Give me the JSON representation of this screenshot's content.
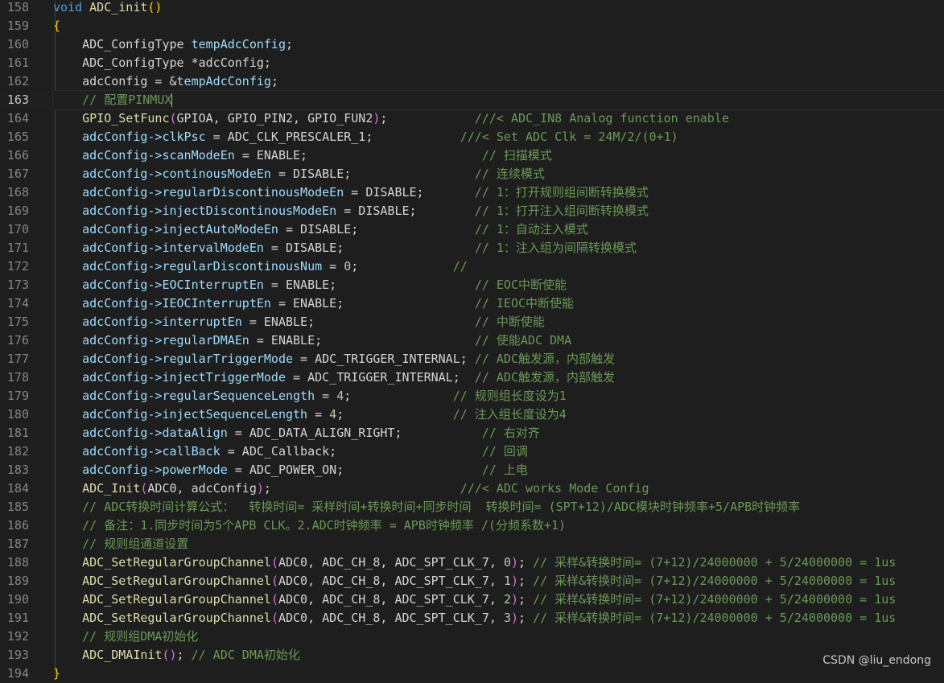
{
  "editor": {
    "current_line": 163,
    "lines": [
      {
        "n": 158,
        "tokens": [
          [
            "kw",
            "void "
          ],
          [
            "fn",
            "ADC_init"
          ],
          [
            "brace",
            "()"
          ]
        ]
      },
      {
        "n": 159,
        "tokens": [
          [
            "brace",
            "{"
          ]
        ]
      },
      {
        "n": 160,
        "tokens": [
          [
            "ty",
            "    ADC_ConfigType "
          ],
          [
            "var",
            "tempAdcConfig"
          ],
          [
            "ty",
            ";"
          ]
        ]
      },
      {
        "n": 161,
        "tokens": [
          [
            "ty",
            "    ADC_ConfigType *adcConfig;"
          ]
        ]
      },
      {
        "n": 162,
        "tokens": [
          [
            "ty",
            "    adcConfig = &"
          ],
          [
            "var",
            "tempAdcConfig"
          ],
          [
            "ty",
            ";"
          ]
        ]
      },
      {
        "n": 163,
        "tokens": [
          [
            "com",
            "    // 配置PINMUX"
          ]
        ],
        "cursor": true
      },
      {
        "n": 164,
        "tokens": [
          [
            "fn",
            "    GPIO_SetFunc"
          ],
          [
            "paren",
            "("
          ],
          [
            "ty",
            "GPIOA, GPIO_PIN2, GPIO_FUN2"
          ],
          [
            "paren",
            ")"
          ],
          [
            "ty",
            ";            "
          ],
          [
            "com",
            "///< ADC_IN8 Analog function enable"
          ]
        ]
      },
      {
        "n": 165,
        "tokens": [
          [
            "var",
            "    adcConfig->clkPsc"
          ],
          [
            "ty",
            " = ADC_CLK_PRESCALER_1;            "
          ],
          [
            "com",
            "///< Set ADC Clk = 24M/2/(0+1)"
          ]
        ]
      },
      {
        "n": 166,
        "tokens": [
          [
            "var",
            "    adcConfig->scanModeEn"
          ],
          [
            "ty",
            " = ENABLE;                        "
          ],
          [
            "com",
            "// 扫描模式"
          ]
        ]
      },
      {
        "n": 167,
        "tokens": [
          [
            "var",
            "    adcConfig->continousModeEn"
          ],
          [
            "ty",
            " = DISABLE;                 "
          ],
          [
            "com",
            "// 连续模式"
          ]
        ]
      },
      {
        "n": 168,
        "tokens": [
          [
            "var",
            "    adcConfig->regularDiscontinousModeEn"
          ],
          [
            "ty",
            " = DISABLE;       "
          ],
          [
            "com",
            "// 1：打开规则组间断转换模式"
          ]
        ]
      },
      {
        "n": 169,
        "tokens": [
          [
            "var",
            "    adcConfig->injectDiscontinousModeEn"
          ],
          [
            "ty",
            " = DISABLE;        "
          ],
          [
            "com",
            "// 1：打开注入组间断转换模式"
          ]
        ]
      },
      {
        "n": 170,
        "tokens": [
          [
            "var",
            "    adcConfig->injectAutoModeEn"
          ],
          [
            "ty",
            " = DISABLE;                "
          ],
          [
            "com",
            "// 1：自动注入模式"
          ]
        ]
      },
      {
        "n": 171,
        "tokens": [
          [
            "var",
            "    adcConfig->intervalModeEn"
          ],
          [
            "ty",
            " = DISABLE;                  "
          ],
          [
            "com",
            "// 1：注入组为间隔转换模式"
          ]
        ]
      },
      {
        "n": 172,
        "tokens": [
          [
            "var",
            "    adcConfig->regularDiscontinousNum"
          ],
          [
            "ty",
            " = "
          ],
          [
            "num",
            "0"
          ],
          [
            "ty",
            ";             "
          ],
          [
            "com",
            "//"
          ]
        ]
      },
      {
        "n": 173,
        "tokens": [
          [
            "var",
            "    adcConfig->EOCInterruptEn"
          ],
          [
            "ty",
            " = ENABLE;                   "
          ],
          [
            "com",
            "// EOC中断使能"
          ]
        ]
      },
      {
        "n": 174,
        "tokens": [
          [
            "var",
            "    adcConfig->IEOCInterruptEn"
          ],
          [
            "ty",
            " = ENABLE;                  "
          ],
          [
            "com",
            "// IEOC中断使能"
          ]
        ]
      },
      {
        "n": 175,
        "tokens": [
          [
            "var",
            "    adcConfig->interruptEn"
          ],
          [
            "ty",
            " = ENABLE;                      "
          ],
          [
            "com",
            "// 中断使能"
          ]
        ]
      },
      {
        "n": 176,
        "tokens": [
          [
            "var",
            "    adcConfig->regularDMAEn"
          ],
          [
            "ty",
            " = ENABLE;                     "
          ],
          [
            "com",
            "// 使能ADC DMA"
          ]
        ]
      },
      {
        "n": 177,
        "tokens": [
          [
            "var",
            "    adcConfig->regularTriggerMode"
          ],
          [
            "ty",
            " = ADC_TRIGGER_INTERNAL; "
          ],
          [
            "com",
            "// ADC触发源，内部触发"
          ]
        ]
      },
      {
        "n": 178,
        "tokens": [
          [
            "var",
            "    adcConfig->injectTriggerMode"
          ],
          [
            "ty",
            " = ADC_TRIGGER_INTERNAL;  "
          ],
          [
            "com",
            "// ADC触发源，内部触发"
          ]
        ]
      },
      {
        "n": 179,
        "tokens": [
          [
            "var",
            "    adcConfig->regularSequenceLength"
          ],
          [
            "ty",
            " = "
          ],
          [
            "num",
            "4"
          ],
          [
            "ty",
            ";              "
          ],
          [
            "com",
            "// 规则组长度设为1"
          ]
        ]
      },
      {
        "n": 180,
        "tokens": [
          [
            "var",
            "    adcConfig->injectSequenceLength"
          ],
          [
            "ty",
            " = "
          ],
          [
            "num",
            "4"
          ],
          [
            "ty",
            ";               "
          ],
          [
            "com",
            "// 注入组长度设为4"
          ]
        ]
      },
      {
        "n": 181,
        "tokens": [
          [
            "var",
            "    adcConfig->dataAlign"
          ],
          [
            "ty",
            " = ADC_DATA_ALIGN_RIGHT;           "
          ],
          [
            "com",
            "// 右对齐"
          ]
        ]
      },
      {
        "n": 182,
        "tokens": [
          [
            "var",
            "    adcConfig->callBack"
          ],
          [
            "ty",
            " = ADC_Callback;                    "
          ],
          [
            "com",
            "// 回调"
          ]
        ]
      },
      {
        "n": 183,
        "tokens": [
          [
            "var",
            "    adcConfig->powerMode"
          ],
          [
            "ty",
            " = ADC_POWER_ON;                   "
          ],
          [
            "com",
            "// 上电"
          ]
        ]
      },
      {
        "n": 184,
        "tokens": [
          [
            "fn",
            "    ADC_Init"
          ],
          [
            "paren",
            "("
          ],
          [
            "ty",
            "ADC0, adcConfig"
          ],
          [
            "paren",
            ")"
          ],
          [
            "ty",
            ";                          "
          ],
          [
            "com",
            "///< ADC works Mode Config"
          ]
        ]
      },
      {
        "n": 185,
        "tokens": [
          [
            "com",
            "    // ADC转换时间计算公式：  转换时间= 采样时间+转换时间+同步时间  转换时间= (SPT+12)/ADC模块时钟频率+5/APB时钟频率"
          ]
        ]
      },
      {
        "n": 186,
        "tokens": [
          [
            "com",
            "    // 备注：1.同步时间为5个APB CLK。2.ADC时钟频率 = APB时钟频率 /(分频系数+1)"
          ]
        ]
      },
      {
        "n": 187,
        "tokens": [
          [
            "com",
            "    // 规则组通道设置"
          ]
        ]
      },
      {
        "n": 188,
        "tokens": [
          [
            "fn",
            "    ADC_SetRegularGroupChannel"
          ],
          [
            "paren",
            "("
          ],
          [
            "ty",
            "ADC0, ADC_CH_8, ADC_SPT_CLK_7, "
          ],
          [
            "num",
            "0"
          ],
          [
            "paren",
            ")"
          ],
          [
            "ty",
            "; "
          ],
          [
            "com",
            "// 采样&转换时间= (7+12)/24000000 + 5/24000000 = 1us"
          ]
        ]
      },
      {
        "n": 189,
        "tokens": [
          [
            "fn",
            "    ADC_SetRegularGroupChannel"
          ],
          [
            "paren",
            "("
          ],
          [
            "ty",
            "ADC0, ADC_CH_8, ADC_SPT_CLK_7, "
          ],
          [
            "num",
            "1"
          ],
          [
            "paren",
            ")"
          ],
          [
            "ty",
            "; "
          ],
          [
            "com",
            "// 采样&转换时间= (7+12)/24000000 + 5/24000000 = 1us"
          ]
        ]
      },
      {
        "n": 190,
        "tokens": [
          [
            "fn",
            "    ADC_SetRegularGroupChannel"
          ],
          [
            "paren",
            "("
          ],
          [
            "ty",
            "ADC0, ADC_CH_8, ADC_SPT_CLK_7, "
          ],
          [
            "num",
            "2"
          ],
          [
            "paren",
            ")"
          ],
          [
            "ty",
            "; "
          ],
          [
            "com",
            "// 采样&转换时间= (7+12)/24000000 + 5/24000000 = 1us"
          ]
        ]
      },
      {
        "n": 191,
        "tokens": [
          [
            "fn",
            "    ADC_SetRegularGroupChannel"
          ],
          [
            "paren",
            "("
          ],
          [
            "ty",
            "ADC0, ADC_CH_8, ADC_SPT_CLK_7, "
          ],
          [
            "num",
            "3"
          ],
          [
            "paren",
            ")"
          ],
          [
            "ty",
            "; "
          ],
          [
            "com",
            "// 采样&转换时间= (7+12)/24000000 + 5/24000000 = 1us"
          ]
        ]
      },
      {
        "n": 192,
        "tokens": [
          [
            "com",
            "    // 规则组DMA初始化"
          ]
        ]
      },
      {
        "n": 193,
        "tokens": [
          [
            "fn",
            "    ADC_DMAInit"
          ],
          [
            "paren",
            "()"
          ],
          [
            "ty",
            "; "
          ],
          [
            "com",
            "// ADC DMA初始化"
          ]
        ]
      },
      {
        "n": 194,
        "tokens": [
          [
            "brace",
            "}"
          ]
        ]
      }
    ]
  },
  "watermark": "CSDN @liu_endong"
}
